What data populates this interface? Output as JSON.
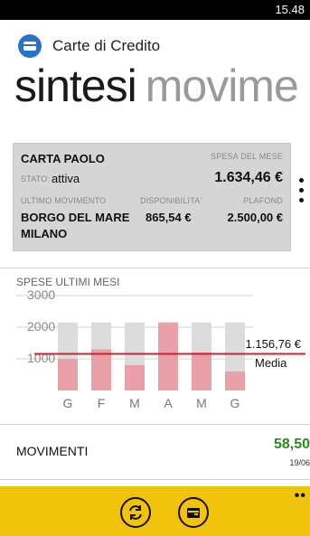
{
  "status_bar": {
    "time": "15.48"
  },
  "header": {
    "title": "Carte di Credito"
  },
  "pivot": {
    "items": [
      "sintesi",
      "movime"
    ]
  },
  "card": {
    "name": "CARTA PAOLO",
    "stato_label": "STATO:",
    "stato_value": "attiva",
    "spesa_label": "SPESA DEL MESE",
    "spesa_value": "1.634,46 €",
    "ultimo_label": "ULTIMO MOVIMENTO",
    "ultimo_value_line1": "BORGO DEL MARE",
    "ultimo_value_line2": "MILANO",
    "disp_label": "DISPONIBILITA'",
    "disp_value": "865,54 €",
    "plafond_label": "PLAFOND",
    "plafond_value": "2.500,00 €"
  },
  "spese": {
    "title": "SPESE ULTIMI MESI",
    "media_value": "1.156,76 €",
    "media_label": "Media"
  },
  "chart_data": {
    "type": "bar",
    "categories": [
      "G",
      "F",
      "M",
      "A",
      "M",
      "G"
    ],
    "values": [
      1000,
      1300,
      800,
      2150,
      1200,
      600
    ],
    "capacity": 2150,
    "average": 1156.76,
    "yticks": [
      1000,
      2000,
      3000
    ],
    "ylim": [
      0,
      3200
    ],
    "colors": {
      "background": "#dcdcdc",
      "value": "#eaa0a8",
      "average": "#c8242e"
    }
  },
  "movimenti": {
    "label": "MOVIMENTI",
    "value": "58,50",
    "date": "19/06"
  },
  "app_bar": {
    "buttons": [
      {
        "icon": "refresh-icon"
      },
      {
        "icon": "wallet-icon"
      }
    ],
    "more": "••"
  }
}
